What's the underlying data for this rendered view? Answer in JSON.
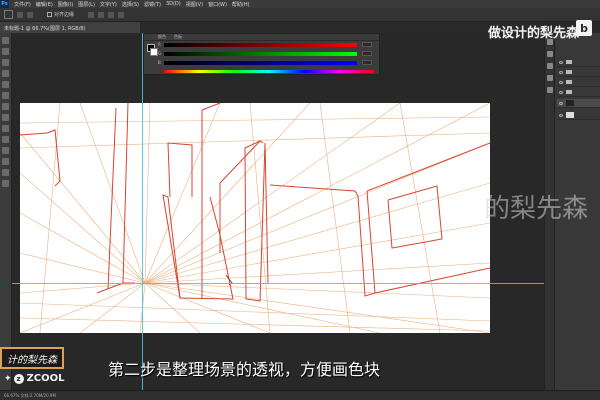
{
  "app": {
    "menu": [
      "文件(F)",
      "编辑(E)",
      "图像(I)",
      "图层(L)",
      "文字(Y)",
      "选择(S)",
      "滤镜(T)",
      "3D(D)",
      "视图(V)",
      "窗口(W)",
      "帮助(H)"
    ],
    "options": {
      "align_edges": "对齐边缘"
    },
    "document_tab": "未标题-1 @ 66.7%(图层 1, RGB/8)",
    "status": "66.67%   文档:2.70M/20.9M"
  },
  "color_panel": {
    "tabs": [
      "颜色",
      "色板"
    ],
    "rows": [
      {
        "label": "R",
        "value": ""
      },
      {
        "label": "G",
        "value": ""
      },
      {
        "label": "B",
        "value": ""
      }
    ],
    "colors": {
      "red_row": "#ff0000",
      "green_row": "#00ff00",
      "blue_row": "#0000ff"
    }
  },
  "watermark": {
    "brand": "做设计的梨先森",
    "brand_logo": "b",
    "canvas_watermark": "的梨先森",
    "box_text": "计的梨先森",
    "site": "ZCOOL"
  },
  "subtitle": "第二步是整理场景的透视，方便画色块",
  "colors": {
    "sketch_red": "#d9442f",
    "grid_orange": "#e8a46a",
    "guide": "#4bc4d8"
  }
}
